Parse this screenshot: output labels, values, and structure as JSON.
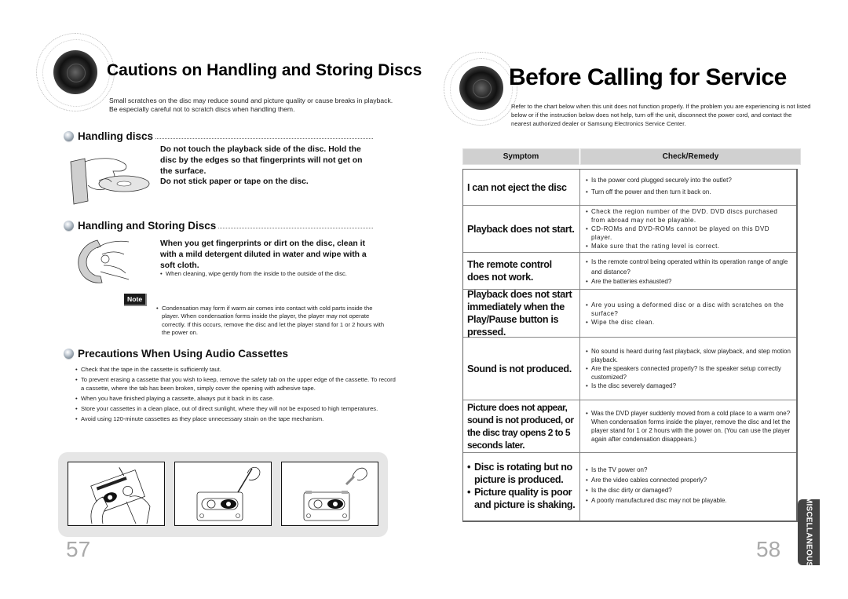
{
  "left_page": {
    "title": "Cautions on Handling and Storing Discs",
    "intro": "Small scratches on the disc may reduce sound and picture quality or cause breaks in playback. Be especially careful not to scratch discs when handling them.",
    "sections": {
      "handling": {
        "heading": "Handling discs",
        "body": [
          "Do not touch the playback side of the disc. Hold the disc by the edges so that fingerprints will not get on the surface.",
          "Do not stick paper or tape on the disc."
        ]
      },
      "storing": {
        "heading": "Handling and Storing Discs",
        "body": "When you get fingerprints or dirt on the disc, clean it with a mild detergent diluted in water and wipe with a soft cloth.",
        "bullet": "When cleaning, wipe gently from the inside to the outside of the disc."
      },
      "note": {
        "label": "Note",
        "text": "Condensation may form if warm air comes into contact with cold parts inside the player. When condensation forms inside the player, the player may not operate correctly. If this occurs, remove the disc and let the player stand for 1 or 2 hours with the power on."
      },
      "cassettes": {
        "heading": "Precautions When Using Audio Cassettes",
        "bullets": [
          "Check that the tape in the cassette is sufficiently taut.",
          "To prevent erasing a cassette that you wish to keep, remove the safety tab on the upper edge of the cassette. To record a cassette, where  the tab has been broken, simply cover the opening with adhesive tape.",
          "When you have finished playing a cassette, always put it back in its case.",
          "Store your cassettes in a clean place, out of direct sunlight, where they will not be exposed to high temperatures.",
          "Avoid using 120-minute cassettes as they place unnecessary strain on the tape mechanism."
        ]
      }
    },
    "illustrations": [
      "hands-tightening-cassette-tape",
      "removing-cassette-safety-tab",
      "covering-tab-opening-with-tape"
    ],
    "page_number": "57"
  },
  "right_page": {
    "title": "Before Calling for Service",
    "intro": "Refer to the chart below when this unit does not function properly. If the problem you are experiencing is not listed below or if the instruction below does not help, turn off the unit, disconnect the power cord, and contact the nearest authorized dealer or Samsung Electronics Service Center.",
    "table": {
      "headers": {
        "symptom": "Symptom",
        "remedy": "Check/Remedy"
      },
      "rows": [
        {
          "symptom": "I can not eject the disc",
          "remedies": [
            "Is the power cord plugged securely into the outlet?",
            "Turn off the power and then turn it back on."
          ]
        },
        {
          "symptom": "Playback does not start.",
          "remedies": [
            "Check the region number of the DVD. DVD discs purchased from abroad may not be playable.",
            "CD-ROMs and DVD-ROMs cannot be played on this DVD player.",
            "Make sure that the rating level is correct."
          ]
        },
        {
          "symptom": "The remote control does not work.",
          "remedies": [
            "Is the remote control being operated within its operation range of angle and distance?",
            "Are the batteries exhausted?"
          ]
        },
        {
          "symptom": "Playback does not start immediately when the Play/Pause button is pressed.",
          "remedies": [
            "Are you using a deformed disc or a disc with scratches on the surface?",
            "Wipe the disc clean."
          ]
        },
        {
          "symptom": "Sound is not produced.",
          "remedies": [
            "No sound is heard during fast playback, slow playback, and step motion playback.",
            "Are the speakers connected properly? Is the speaker setup correctly customized?",
            "Is the disc severely damaged?"
          ]
        },
        {
          "symptom": "Picture does not appear, sound is not produced, or the disc tray opens 2 to 5 seconds later.",
          "remedies": [
            "Was the DVD player suddenly moved from a cold place to a warm one? When condensation forms inside the player, remove the disc and let the player stand for 1 or 2 hours with the power on. (You can use the player again after condensation disappears.)"
          ]
        },
        {
          "symptoms": [
            "Disc is rotating but no picture is produced.",
            "Picture quality is poor and picture is shaking."
          ],
          "remedies": [
            "Is the TV power on?",
            "Are the video cables connected properly?",
            "Is the disc dirty or damaged?",
            "A poorly manufactured disc may not be playable."
          ]
        }
      ]
    },
    "page_number": "58",
    "side_tab": "MISCELLANEOUS"
  }
}
